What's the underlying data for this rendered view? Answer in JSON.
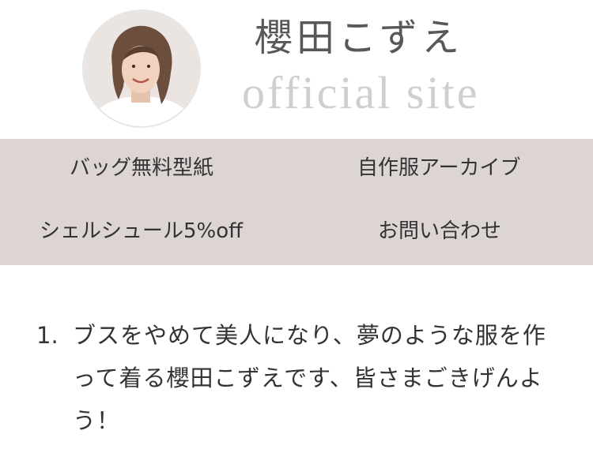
{
  "header": {
    "avatar_alt": "",
    "site_name": "櫻田こずえ",
    "site_subtitle": "official site"
  },
  "nav": {
    "items": [
      {
        "label": "バッグ無料型紙"
      },
      {
        "label": "自作服アーカイブ"
      },
      {
        "label": "シェルシュール5%off"
      },
      {
        "label": "お問い合わせ"
      }
    ]
  },
  "content": {
    "list": [
      {
        "number": "1.",
        "text": "ブスをやめて美人になり、夢のような服を作って着る櫻田こずえです、皆さまごきげんよう！"
      }
    ]
  },
  "colors": {
    "nav_background": "#ddd5d3",
    "site_name": "#585858",
    "site_subtitle": "#cfcfcf",
    "text": "#333333"
  }
}
